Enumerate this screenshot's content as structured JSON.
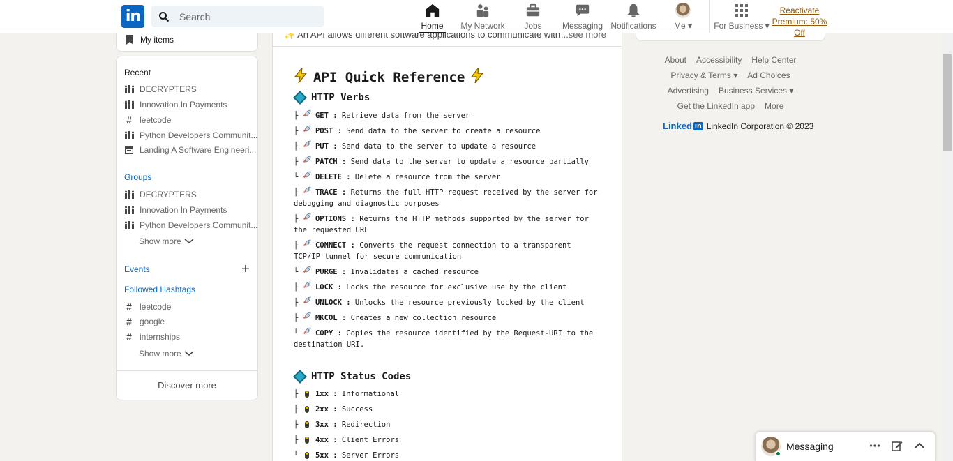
{
  "nav": {
    "search_placeholder": "Search",
    "items": [
      {
        "label": "Home"
      },
      {
        "label": "My Network"
      },
      {
        "label": "Jobs"
      },
      {
        "label": "Messaging"
      },
      {
        "label": "Notifications"
      },
      {
        "label": "Me"
      },
      {
        "label": "For Business"
      }
    ],
    "premium_line1": "Reactivate",
    "premium_line2": "Premium: 50% Off"
  },
  "left": {
    "my_items": "My items",
    "recent_header": "Recent",
    "recent": [
      "DECRYPTERS",
      "Innovation In Payments",
      "leetcode",
      "Python Developers Communit...",
      "Landing A Software Engineeri..."
    ],
    "groups_header": "Groups",
    "groups": [
      "DECRYPTERS",
      "Innovation In Payments",
      "Python Developers Communit..."
    ],
    "show_more": "Show more",
    "events_header": "Events",
    "hashtags_header": "Followed Hashtags",
    "hashtags": [
      "leetcode",
      "google",
      "internships"
    ],
    "discover_more": "Discover more"
  },
  "post": {
    "snippet": "An API allows different software applications to communicate with each other",
    "see_more": "...see more",
    "title": "API Quick Reference",
    "verbs_header": "HTTP Verbs",
    "verbs": [
      {
        "prefix": "├",
        "name": "GET :",
        "desc": " Retrieve data from the server"
      },
      {
        "prefix": "├",
        "name": "POST :",
        "desc": " Send data to the server to create a resource"
      },
      {
        "prefix": "├",
        "name": "PUT :",
        "desc": " Send data to the server to update a resource"
      },
      {
        "prefix": "├",
        "name": "PATCH :",
        "desc": " Send data to the server to update a resource partially"
      },
      {
        "prefix": "└",
        "name": "DELETE :",
        "desc": " Delete a resource from the server"
      },
      {
        "prefix": "├",
        "name": "TRACE :",
        "desc": " Returns the full HTTP request received by the server for debugging and diagnostic purposes"
      },
      {
        "prefix": "├",
        "name": "OPTIONS :",
        "desc": " Returns the HTTP methods supported by the server for the requested URL"
      },
      {
        "prefix": "├",
        "name": "CONNECT :",
        "desc": " Converts the request connection to a transparent TCP/IP tunnel for secure communication"
      },
      {
        "prefix": "└",
        "name": "PURGE :",
        "desc": " Invalidates a cached resource"
      },
      {
        "prefix": "├",
        "name": "LOCK :",
        "desc": " Locks the resource for exclusive use by the client"
      },
      {
        "prefix": "├",
        "name": "UNLOCK :",
        "desc": " Unlocks the resource previously locked by the client"
      },
      {
        "prefix": "├",
        "name": "MKCOL :",
        "desc": " Creates a new collection resource"
      },
      {
        "prefix": "└",
        "name": "COPY :",
        "desc": " Copies the resource identified by the Request-URI to the destination URI."
      }
    ],
    "status_header": "HTTP Status Codes",
    "statuses": [
      {
        "prefix": "├",
        "name": "1xx :",
        "desc": " Informational"
      },
      {
        "prefix": "├",
        "name": "2xx :",
        "desc": " Success"
      },
      {
        "prefix": "├",
        "name": "3xx :",
        "desc": " Redirection"
      },
      {
        "prefix": "├",
        "name": "4xx :",
        "desc": " Client Errors"
      },
      {
        "prefix": "└",
        "name": "5xx :",
        "desc": " Server Errors"
      }
    ]
  },
  "footer": {
    "row1": [
      "About",
      "Accessibility",
      "Help Center"
    ],
    "privacy": "Privacy & Terms",
    "ad_choices": "Ad Choices",
    "advertising": "Advertising",
    "business_services": "Business Services",
    "get_app": "Get the LinkedIn app",
    "more": "More",
    "logo_word": "Linked",
    "logo_in": "in",
    "corp": "LinkedIn Corporation © 2023"
  },
  "messaging": {
    "label": "Messaging"
  },
  "colors": {
    "brand": "#0a66c2",
    "premium": "#915907"
  }
}
